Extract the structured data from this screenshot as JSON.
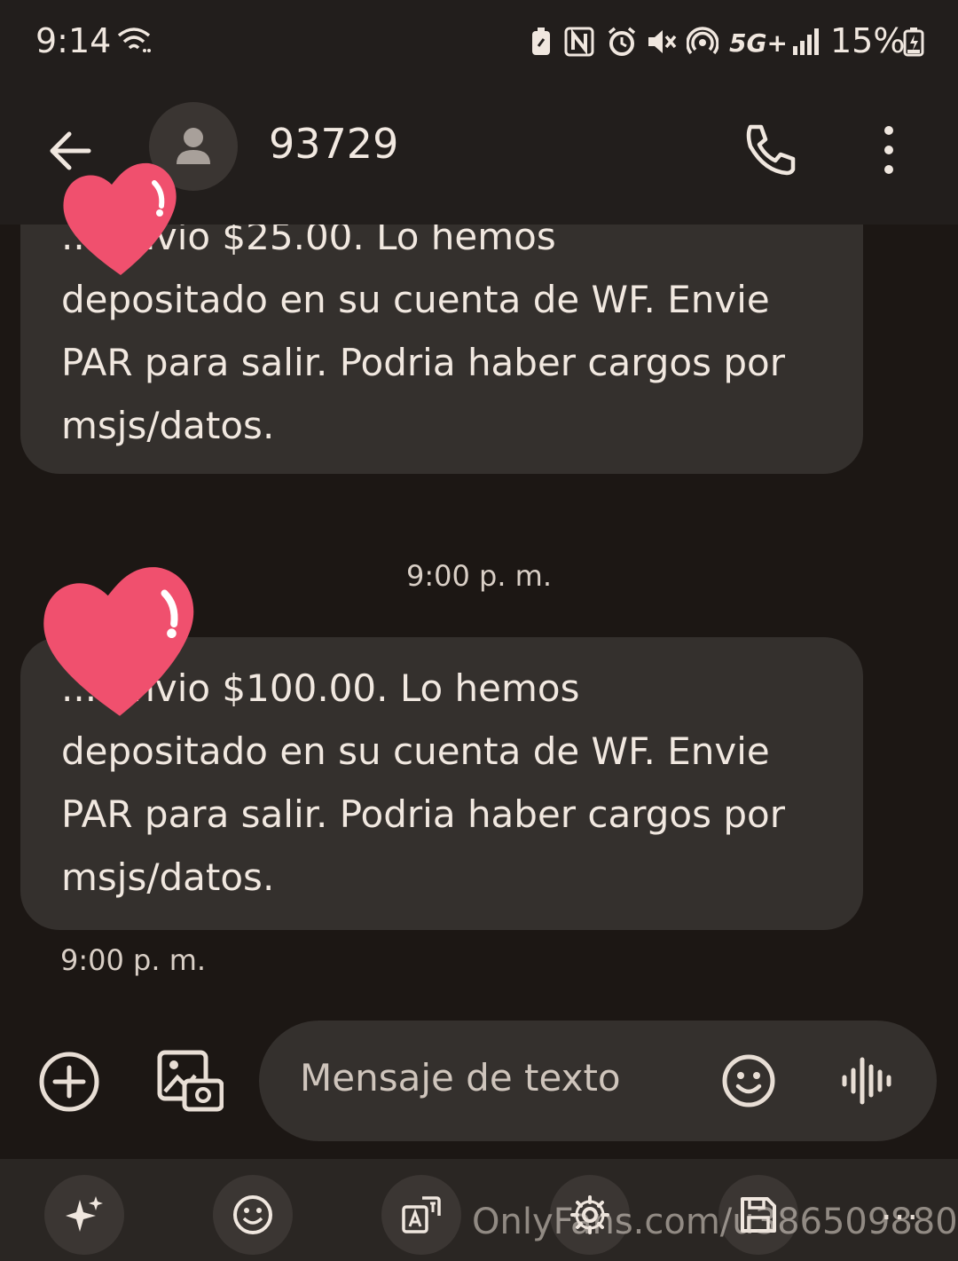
{
  "status_bar": {
    "time": "9:14",
    "network": "5G+",
    "battery": "15%",
    "icons": [
      "wifi-icon",
      "battery-saver-icon",
      "nfc-icon",
      "alarm-icon",
      "mute-icon",
      "hotspot-icon",
      "5g-icon",
      "signal-icon",
      "battery-charging-icon"
    ]
  },
  "header": {
    "contact": "93729",
    "icons": [
      "back-arrow-icon",
      "person-avatar-icon",
      "phone-icon",
      "more-vert-icon"
    ]
  },
  "conversation": {
    "messages": [
      {
        "text": "... envio $25.00. Lo hemos\ndepositado en su cuenta de WF. Envie\nPAR para salir. Podria haber cargos por\nmsjs/datos."
      },
      {
        "text": "... envio $100.00. Lo hemos\ndepositado en su cuenta de WF. Envie\nPAR para salir. Podria haber cargos por\nmsjs/datos."
      }
    ],
    "timestamp_center": "9:00 p. m.",
    "timestamp_last": "9:00 p. m."
  },
  "composer": {
    "placeholder": "Mensaje de texto",
    "icons": [
      "add-circle-icon",
      "gallery-camera-icon",
      "emoji-icon",
      "voice-wave-icon"
    ]
  },
  "keyboard_toolbar": {
    "icons": [
      "sparkle-icon",
      "emoji-icon",
      "translate-icon",
      "settings-icon",
      "save-icon"
    ],
    "more": "..."
  },
  "watermark": "OnlyFans.com/u386509880",
  "colors": {
    "background": "#1c1714",
    "bar": "#221e1c",
    "bubble": "#34302d",
    "heart": "#f0506e"
  }
}
